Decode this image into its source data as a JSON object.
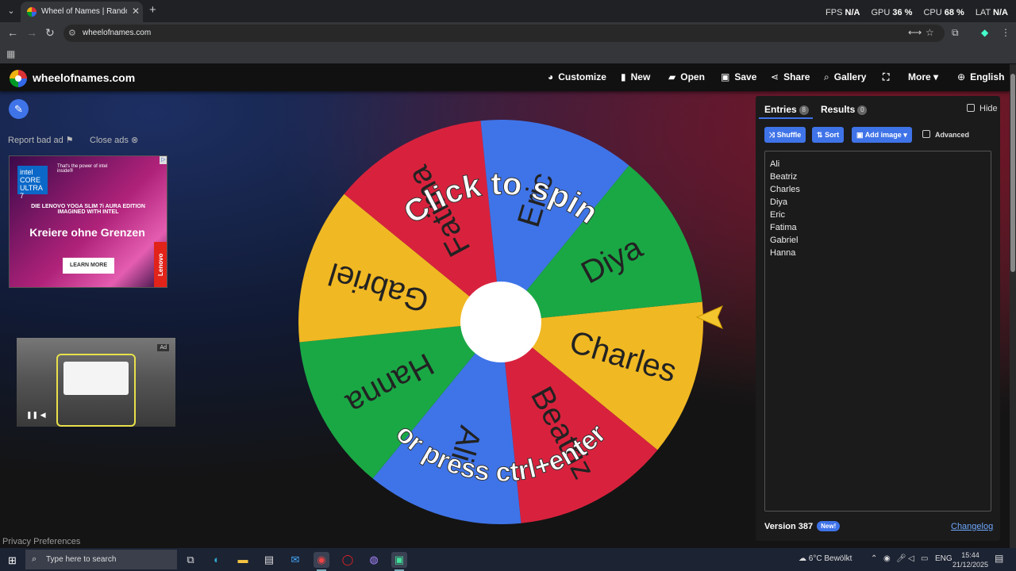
{
  "browser": {
    "tab_title": "Wheel of Names | Random nam",
    "url": "wheelofnames.com",
    "stats": [
      {
        "label": "FPS",
        "value": "N/A"
      },
      {
        "label": "GPU",
        "value": "36 %"
      },
      {
        "label": "CPU",
        "value": "68 %"
      },
      {
        "label": "LAT",
        "value": "N/A"
      }
    ]
  },
  "site": {
    "name": "wheelofnames.com",
    "menu": [
      {
        "icon": "palette-icon",
        "glyph": "◕",
        "label": "Customize"
      },
      {
        "icon": "file-icon",
        "glyph": "▮",
        "label": "New"
      },
      {
        "icon": "folder-icon",
        "glyph": "▰",
        "label": "Open"
      },
      {
        "icon": "save-icon",
        "glyph": "▣",
        "label": "Save"
      },
      {
        "icon": "share-icon",
        "glyph": "⋖",
        "label": "Share"
      },
      {
        "icon": "search-icon",
        "glyph": "⌕",
        "label": "Gallery"
      },
      {
        "icon": "fullscreen-icon",
        "glyph": "⛶",
        "label": ""
      },
      {
        "icon": "chevron-down-icon",
        "glyph": "▾",
        "label": "More"
      },
      {
        "icon": "globe-icon",
        "glyph": "⊕",
        "label": "English"
      }
    ]
  },
  "ads": {
    "report": "Report bad ad",
    "close": "Close ads",
    "banner": {
      "intel": "intel CORE ULTRA 7",
      "tagline": "That's the power of intel inside®",
      "product": "DIE LENOVO YOGA SLIM 7i AURA EDITION IMAGINED WITH INTEL",
      "headline": "Kreiere ohne Grenzen",
      "cta": "LEARN MORE",
      "brand": "Lenovo"
    },
    "video_tag": "Ad"
  },
  "privacy": "Privacy Preferences",
  "wheel": {
    "slices": [
      "Charles",
      "Beatriz",
      "Ali",
      "Hanna",
      "Gabriel",
      "Fatima",
      "Eric",
      "Diya"
    ],
    "colors": [
      "#f0b823",
      "#d8223d",
      "#3f74e8",
      "#1aa845"
    ],
    "top_text": "Click to spin",
    "bottom_text": "or press ctrl+enter"
  },
  "panel": {
    "tab_entries": "Entries",
    "entries_count": "8",
    "tab_results": "Results",
    "results_count": "0",
    "hide": "Hide",
    "shuffle": "Shuffle",
    "sort": "Sort",
    "add_image": "Add image",
    "advanced": "Advanced",
    "entries": [
      "Ali",
      "Beatriz",
      "Charles",
      "Diya",
      "Eric",
      "Fatima",
      "Gabriel",
      "Hanna"
    ],
    "version": "Version 387",
    "new_badge": "New!",
    "changelog": "Changelog"
  },
  "taskbar": {
    "search_placeholder": "Type here to search",
    "weather": "6°C  Bewölkt",
    "lang": "ENG",
    "time": "15:44",
    "date": "21/12/2025"
  }
}
